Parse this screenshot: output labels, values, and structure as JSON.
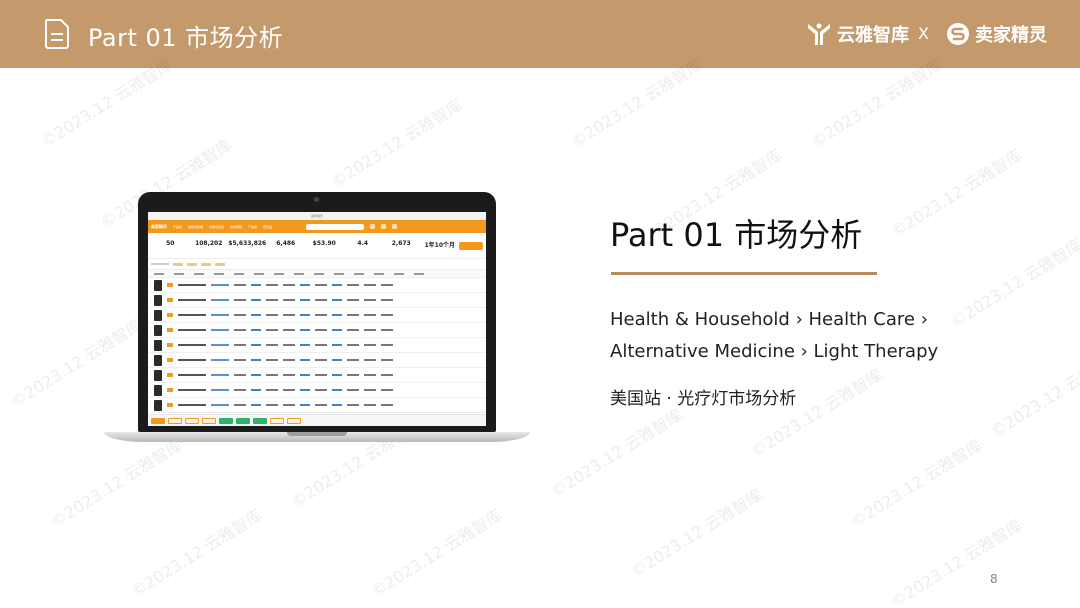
{
  "header": {
    "title": "Part 01 市场分析",
    "brand_left": "云雅智库",
    "separator": "X",
    "brand_right": "卖家精灵",
    "background_color": "#c49a6c"
  },
  "watermark": "©2023.12 云雅智库",
  "slide": {
    "heading": "Part 01  市场分析",
    "category_line1": "Health & Household › Health Care ›",
    "category_line2": "Alternative Medicine › Light Therapy",
    "subtitle": "美国站 · 光疗灯市场分析",
    "page_number": "8",
    "accent_color": "#b68a5c"
  },
  "screenshot": {
    "window_title": "卖家精灵",
    "logo": "卖家精灵",
    "nav": [
      "产品库",
      "关键词挖掘",
      "关键词反查",
      "市场调研",
      "产品库",
      "查竞品"
    ],
    "stats": [
      {
        "value": "50"
      },
      {
        "value": "108,202"
      },
      {
        "value": "$5,633,826"
      },
      {
        "value": "6,486"
      },
      {
        "value": "$53.90"
      },
      {
        "value": "4.4"
      },
      {
        "value": "2,673"
      },
      {
        "value": "1年10个月"
      }
    ]
  }
}
